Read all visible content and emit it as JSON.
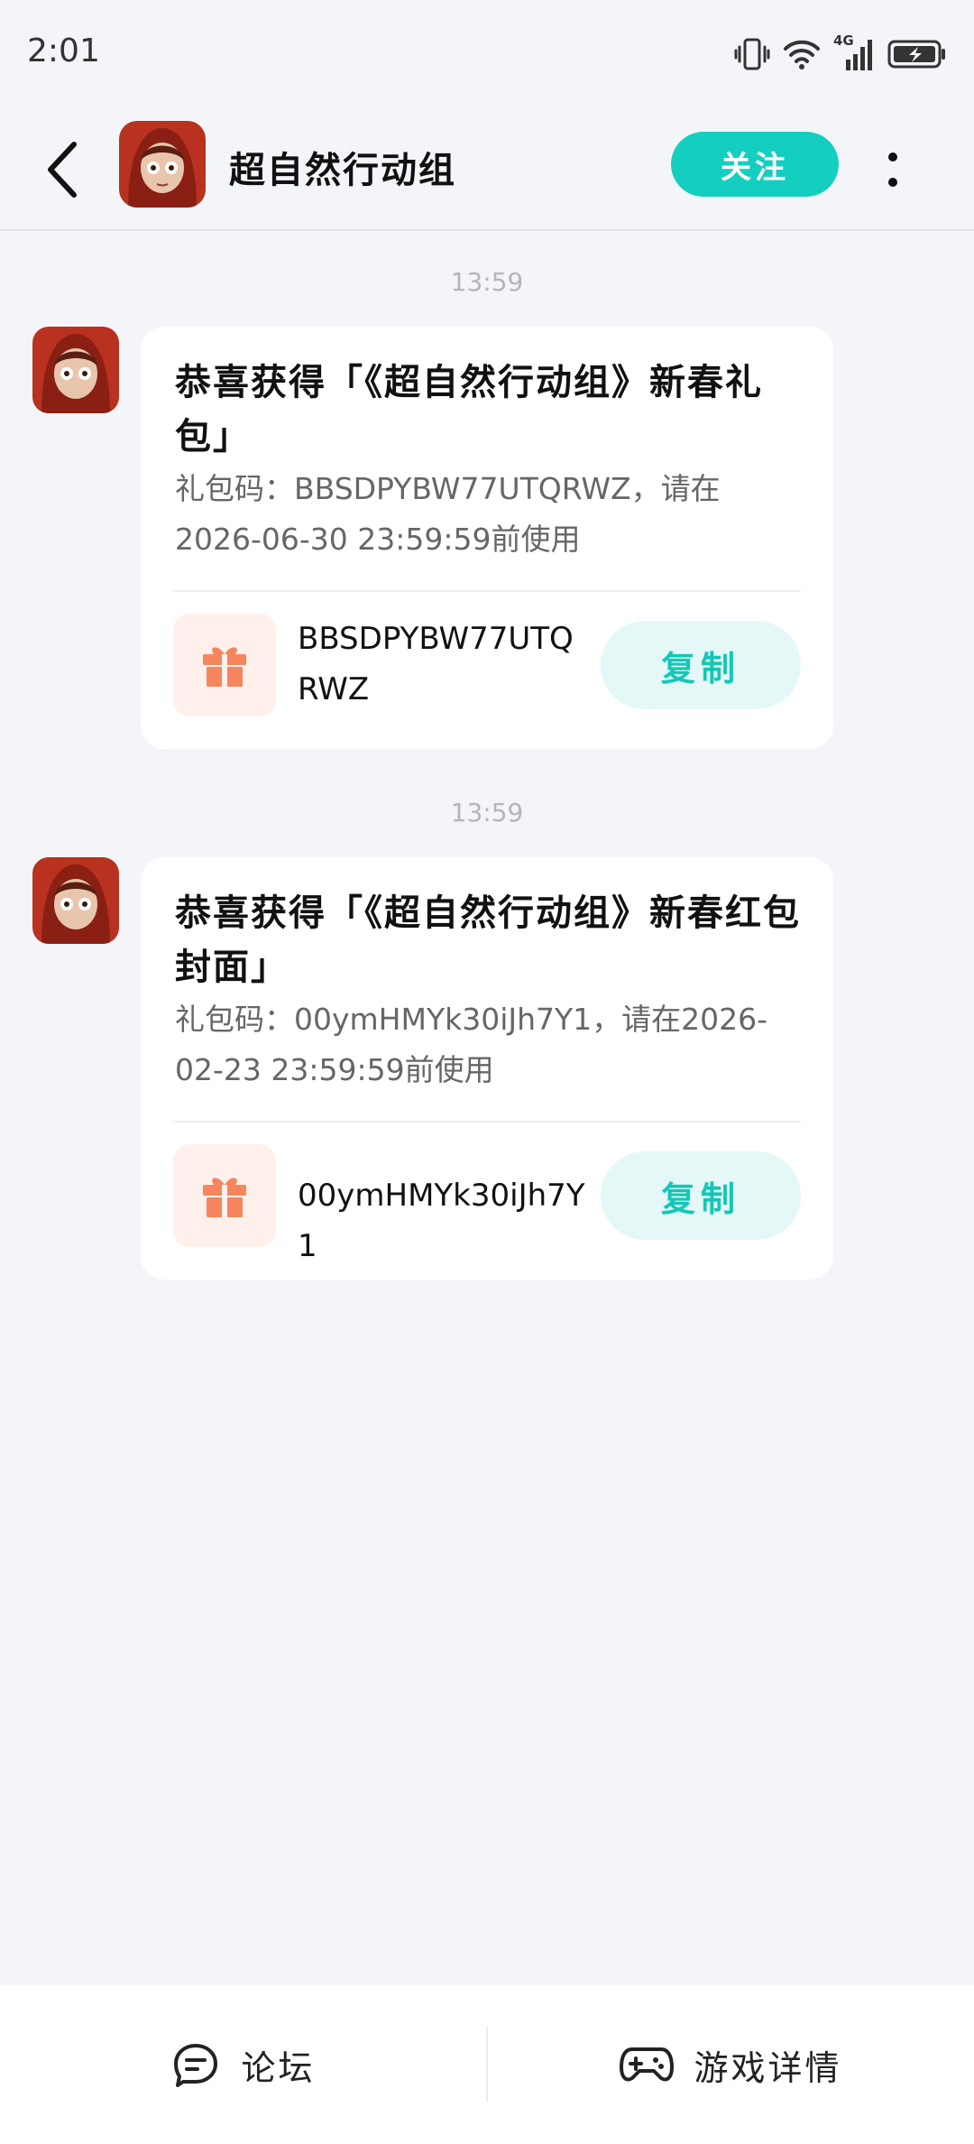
{
  "status_bar": {
    "time": "2:01",
    "network": "4G"
  },
  "header": {
    "title": "超自然行动组",
    "follow_label": "关注"
  },
  "messages": [
    {
      "time": "13:59",
      "title": "恭喜获得「《超自然行动组》新春礼包」",
      "desc": "礼包码：BBSDPYBW77UTQRWZ，请在2026-06-30 23:59:59前使用",
      "code": "BBSDPYBW77UTQRWZ",
      "copy_label": "复制"
    },
    {
      "time": "13:59",
      "title": "恭喜获得「《超自然行动组》新春红包封面」",
      "desc": "礼包码：00ymHMYk30iJh7Y1，请在2026-02-23 23:59:59前使用",
      "code": "00ymHMYk30iJh7Y1",
      "copy_label": "复制"
    }
  ],
  "bottom_bar": {
    "forum_label": "论坛",
    "game_detail_label": "游戏详情"
  },
  "colors": {
    "accent": "#14cfc0",
    "gift_icon": "#f5855c",
    "background": "#f4f5f9"
  }
}
